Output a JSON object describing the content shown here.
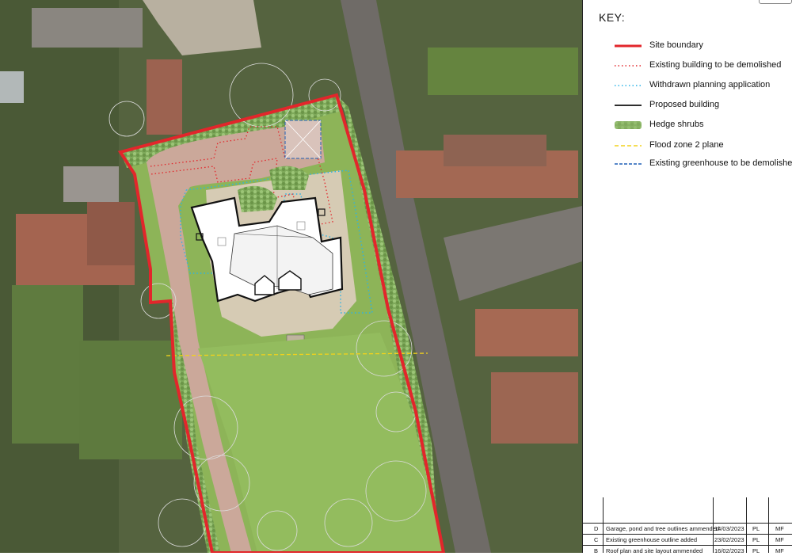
{
  "key": {
    "title": "KEY:",
    "items": [
      {
        "label": "Site boundary",
        "symbol": "solid-line",
        "color": "#e2262b"
      },
      {
        "label": "Existing building to be demolished",
        "symbol": "dotted-line",
        "color": "#e2262b"
      },
      {
        "label": "Withdrawn planning application",
        "symbol": "dotted-line",
        "color": "#29b3e8"
      },
      {
        "label": "Proposed building",
        "symbol": "solid-line",
        "color": "#111111"
      },
      {
        "label": "Hedge shrubs",
        "symbol": "hedge-swatch",
        "color": "#8fb86a"
      },
      {
        "label": "Flood zone 2 plane",
        "symbol": "dashed-line",
        "color": "#f2d21b"
      },
      {
        "label": "Existing greenhouse to be demolished",
        "symbol": "dashed-line",
        "color": "#1f5fb5"
      }
    ]
  },
  "revisions": [
    {
      "rev": "D",
      "description": "Garage, pond and tree outlines ammended",
      "date": "14/03/2023",
      "by": "PL",
      "checked": "MF"
    },
    {
      "rev": "C",
      "description": "Existing greenhouse outline added",
      "date": "23/02/2023",
      "by": "PL",
      "checked": "MF"
    },
    {
      "rev": "B",
      "description": "Roof plan and site layout ammended",
      "date": "16/02/2023",
      "by": "PL",
      "checked": "MF"
    }
  ],
  "colors": {
    "aerial_dark": "#4d5a3c",
    "lawn": "#8fb55a",
    "driveway": "#c9a79a",
    "terrace": "#d8cdb6",
    "road": "#6e6a66",
    "roof_red": "#a8634d"
  }
}
